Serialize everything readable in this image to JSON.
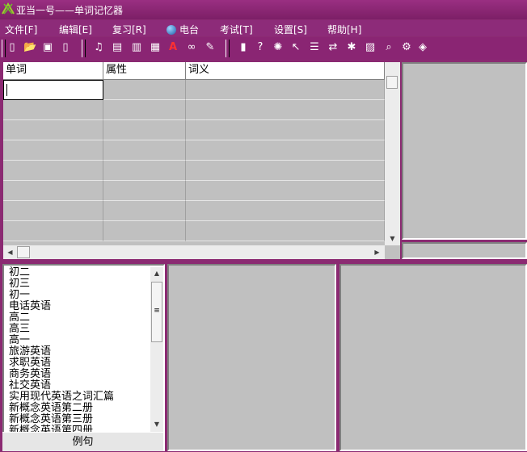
{
  "window": {
    "title": "亚当一号——单词记忆器"
  },
  "menu": [
    "文件[F]",
    "编辑[E]",
    "复习[R]",
    "电台",
    "考试[T]",
    "设置[S]",
    "帮助[H]"
  ],
  "toolbar": {
    "group1": [
      "new-icon",
      "open-icon",
      "save-icon",
      "page-icon"
    ],
    "group2": [
      "speaker-icon",
      "import-icon",
      "export-icon",
      "picture-icon",
      "font-icon",
      "find-icon",
      "replace-icon"
    ],
    "group3": [
      "book-icon",
      "help-icon",
      "options-icon",
      "pointer-help-icon",
      "list-icon",
      "translate-icon",
      "recorder-icon",
      "chart-icon",
      "zoom-icon",
      "settings-icon",
      "eraser-icon"
    ]
  },
  "grid": {
    "columns": [
      "单词",
      "属性",
      "词义"
    ],
    "rows": 8
  },
  "wordbooks": [
    "初二",
    "初三",
    "初一",
    "电话英语",
    "高二",
    "高三",
    "高一",
    "旅游英语",
    "求职英语",
    "商务英语",
    "社交英语",
    "实用现代英语之词汇篇",
    "新概念英语第二册",
    "新概念英语第三册",
    "新概念英语第四册"
  ],
  "example_button": "例句",
  "colors": {
    "accent": "#8b2a72",
    "panel": "#c0c0c0"
  }
}
